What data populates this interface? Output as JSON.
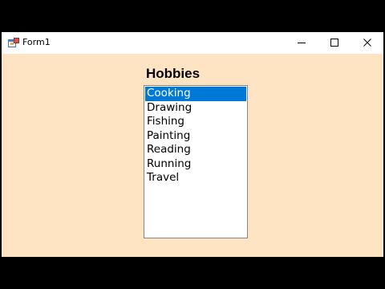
{
  "window": {
    "title": "Form1",
    "controls": {
      "minimize_icon": "minimize-icon",
      "maximize_icon": "maximize-icon",
      "close_icon": "close-icon"
    }
  },
  "form": {
    "label": "Hobbies",
    "listbox": {
      "selected_index": 0,
      "items": [
        "Cooking",
        "Drawing",
        "Fishing",
        "Painting",
        "Reading",
        "Running",
        "Travel"
      ]
    }
  },
  "colors": {
    "form_background": "#ffe4c4",
    "selection": "#0078d7",
    "titlebar": "#ffffff"
  }
}
